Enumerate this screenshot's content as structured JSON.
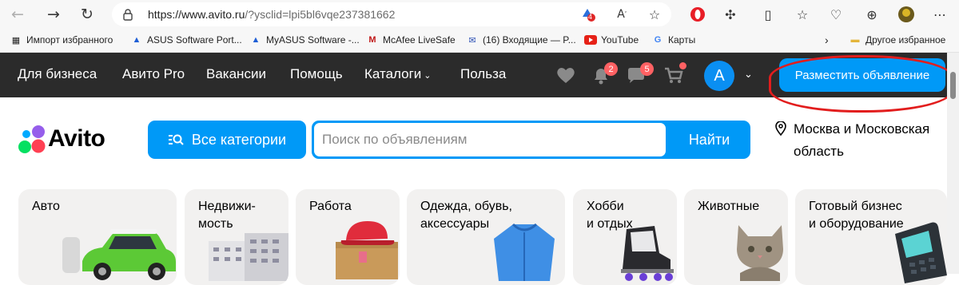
{
  "browser": {
    "url_host": "https://www.avito.ru",
    "url_path": "/?ysclid=lpi5bl6vqe237381662",
    "ext_badge": "4",
    "favorites": [
      {
        "label": "Импорт избранного",
        "icon": "import-icon"
      },
      {
        "label": "ASUS Software Port...",
        "icon": "asus-icon"
      },
      {
        "label": "MyASUS Software -...",
        "icon": "asus-icon"
      },
      {
        "label": "McAfee LiveSafe",
        "icon": "mcafee-icon"
      },
      {
        "label": "(16) Входящие — P...",
        "icon": "mail-icon"
      },
      {
        "label": "YouTube",
        "icon": "youtube-icon"
      },
      {
        "label": "Карты",
        "icon": "google-icon"
      }
    ],
    "other_favorites": "Другое избранное"
  },
  "topbar": {
    "links": [
      "Для бизнеса",
      "Авито Pro",
      "Вакансии",
      "Помощь",
      "Каталоги",
      "Польза"
    ],
    "notifications_count": "2",
    "messages_count": "5",
    "avatar_letter": "A",
    "post_button": "Разместить объявление"
  },
  "search": {
    "logo": "Avito",
    "categories_button": "Все категории",
    "placeholder": "Поиск по объявлениям",
    "find_button": "Найти",
    "location": "Москва и Московская область"
  },
  "categories": [
    {
      "label": "Авто",
      "image": "car"
    },
    {
      "label": "Недвижи-\nмость",
      "image": "building"
    },
    {
      "label": "Работа",
      "image": "cap-box"
    },
    {
      "label": "Одежда, обувь,\nаксессуары",
      "image": "jacket"
    },
    {
      "label": "Хобби\nи отдых",
      "image": "skates"
    },
    {
      "label": "Животные",
      "image": "cat"
    },
    {
      "label": "Готовый бизнес\nи оборудование",
      "image": "terminal"
    }
  ],
  "colors": {
    "accent": "#0099f7",
    "topbar_bg": "#2b2b2b",
    "badge": "#ff6163",
    "highlight_ring": "#e21d1d"
  }
}
